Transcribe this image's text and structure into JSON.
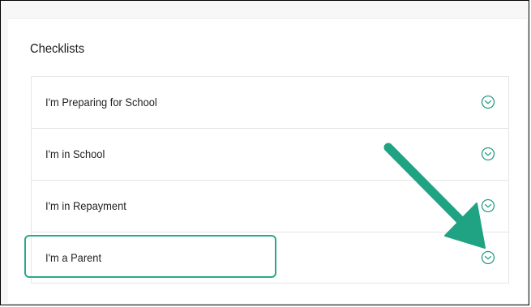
{
  "section": {
    "title": "Checklists"
  },
  "checklists": [
    {
      "label": "I'm Preparing for School",
      "icon": "chevron-down-circle-icon"
    },
    {
      "label": "I'm in School",
      "icon": "chevron-down-circle-icon"
    },
    {
      "label": "I'm in Repayment",
      "icon": "chevron-down-circle-icon"
    },
    {
      "label": "I'm a Parent",
      "icon": "chevron-down-circle-icon"
    }
  ],
  "colors": {
    "accent_teal": "#29a98b",
    "chevron": "#2a9d85",
    "annotation_arrow": "#1fa383"
  }
}
